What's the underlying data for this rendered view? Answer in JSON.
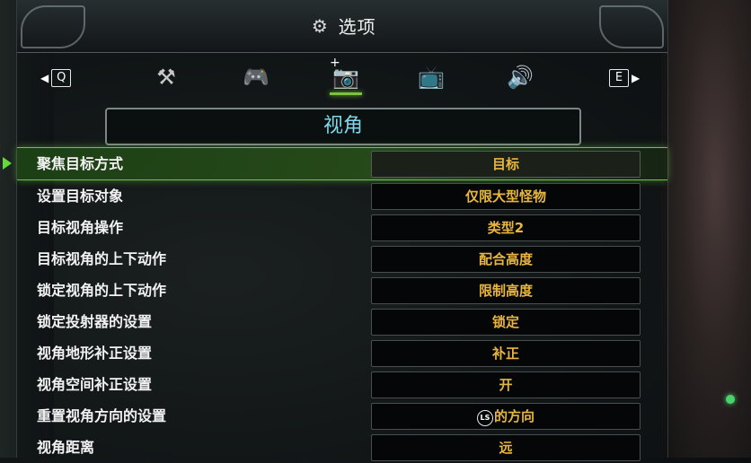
{
  "header": {
    "title": "选项",
    "icon": "gear-icon"
  },
  "tabs": {
    "prev_key": "Q",
    "next_key": "E",
    "items": [
      {
        "icon": "tools-icon",
        "glyph": "⚒"
      },
      {
        "icon": "controller-icon",
        "glyph": "🎮"
      },
      {
        "icon": "camera-icon",
        "glyph": "📷",
        "active": true
      },
      {
        "icon": "display-icon",
        "glyph": "📺"
      },
      {
        "icon": "speaker-icon",
        "glyph": "🔊"
      }
    ]
  },
  "section": {
    "title": "视角"
  },
  "rows": [
    {
      "label": "聚焦目标方式",
      "value": "目标"
    },
    {
      "label": "设置目标对象",
      "value": "仅限大型怪物"
    },
    {
      "label": "目标视角操作",
      "value": "类型2"
    },
    {
      "label": "目标视角的上下动作",
      "value": "配合高度"
    },
    {
      "label": "锁定视角的上下动作",
      "value": "限制高度"
    },
    {
      "label": "锁定投射器的设置",
      "value": "锁定"
    },
    {
      "label": "视角地形补正设置",
      "value": "补正"
    },
    {
      "label": "视角空间补正设置",
      "value": "开"
    },
    {
      "label": "重置视角方向的设置",
      "value": "的方向",
      "badge": "LS"
    },
    {
      "label": "视角距离",
      "value": "远"
    }
  ],
  "colors": {
    "accent_green": "#6fc34a",
    "value_gold": "#e8b63d",
    "section_title": "#7fd8e8"
  }
}
